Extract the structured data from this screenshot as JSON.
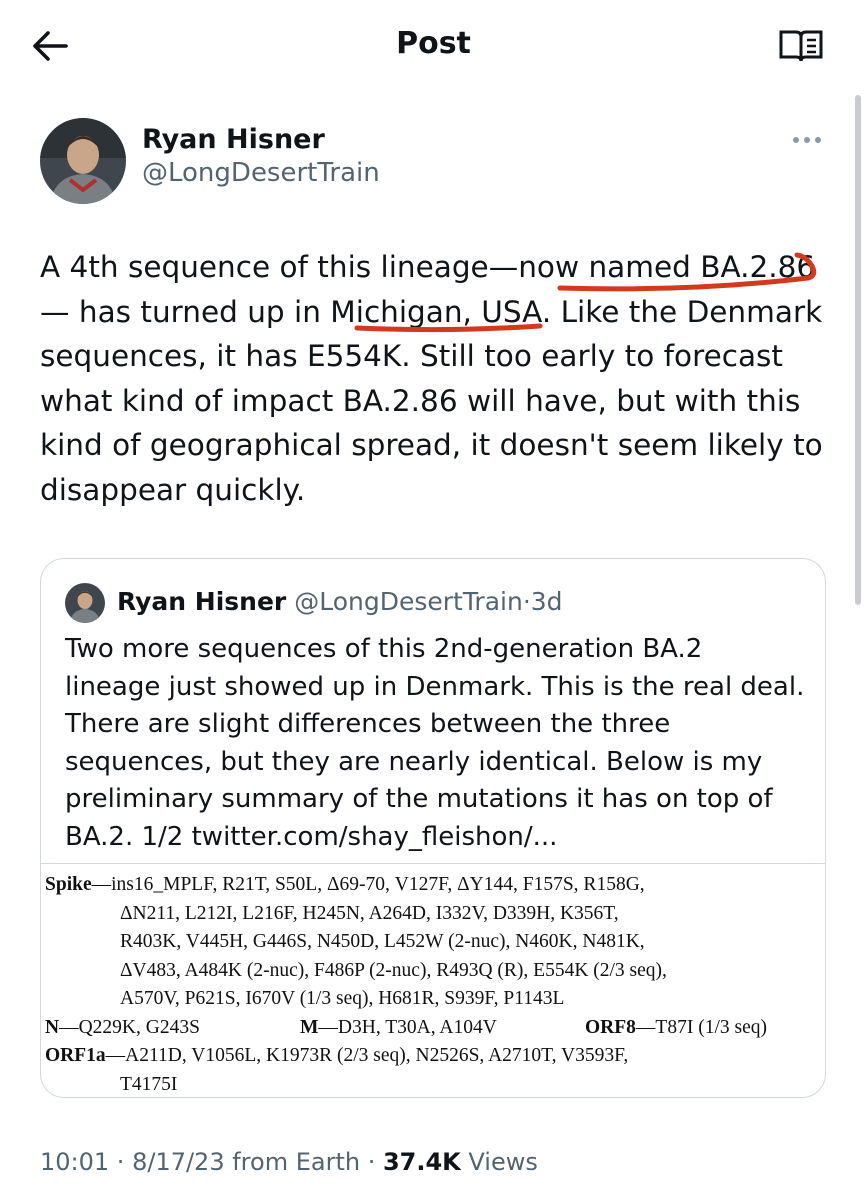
{
  "header": {
    "title": "Post",
    "back_icon": "arrow-left-icon",
    "reader_icon": "reader-mode-icon"
  },
  "author": {
    "name": "Ryan Hisner",
    "handle": "@LongDesertTrain"
  },
  "post": {
    "lines": [
      "A 4th sequence of this lineage—now named BA.2.86",
      "— has turned up in Michigan, USA. Like the Denmark",
      "sequences, it has E554K. Still too early to forecast",
      "what kind of impact BA.2.86 will have, but with this",
      "kind of geographical spread, it doesn't seem likely to",
      "disappear quickly."
    ],
    "annotation_color": "#d23a1e"
  },
  "quote": {
    "name": "Ryan Hisner",
    "handle": "@LongDesertTrain",
    "separator": "·",
    "time": "3d",
    "lines": [
      "Two more sequences of this 2nd-generation BA.2",
      "lineage just showed up in Denmark. This is the real deal.",
      "There are slight differences between the three",
      "sequences, but they are nearly identical. Below is my",
      "preliminary summary of the mutations it has on top of",
      "BA.2. 1/2 twitter.com/shay_fleishon/..."
    ],
    "mutations": {
      "spike_label": "Spike",
      "spike_lines": [
        "—ins16_MPLF, R21T, S50L, Δ69-70, V127F, ΔY144, F157S, R158G,",
        "ΔN211, L212I, L216F, H245N, A264D, I332V, D339H, K356T,",
        "R403K, V445H, G446S, N450D, L452W (2-nuc), N460K, N481K,",
        "ΔV483, A484K (2-nuc), F486P (2-nuc), R493Q (R), E554K (2/3 seq),",
        "A570V, P621S, I670V (1/3 seq), H681R, S939F, P1143L"
      ],
      "n_label": "N",
      "n_text": "—Q229K, G243S",
      "m_label": "M",
      "m_text": "—D3H, T30A, A104V",
      "orf8_label": "ORF8",
      "orf8_text": "—T87I (1/3 seq)",
      "orf1a_label": "ORF1a",
      "orf1a_lines": [
        "—A211D, V1056L, K1973R (2/3 seq), N2526S, A2710T, V3593F,",
        "T4175I"
      ]
    }
  },
  "footer": {
    "time": "10:01",
    "sep1": " · ",
    "date": "8/17/23",
    "source": " from Earth",
    "sep2": " · ",
    "views_count": "37.4K",
    "views_label": " Views"
  }
}
